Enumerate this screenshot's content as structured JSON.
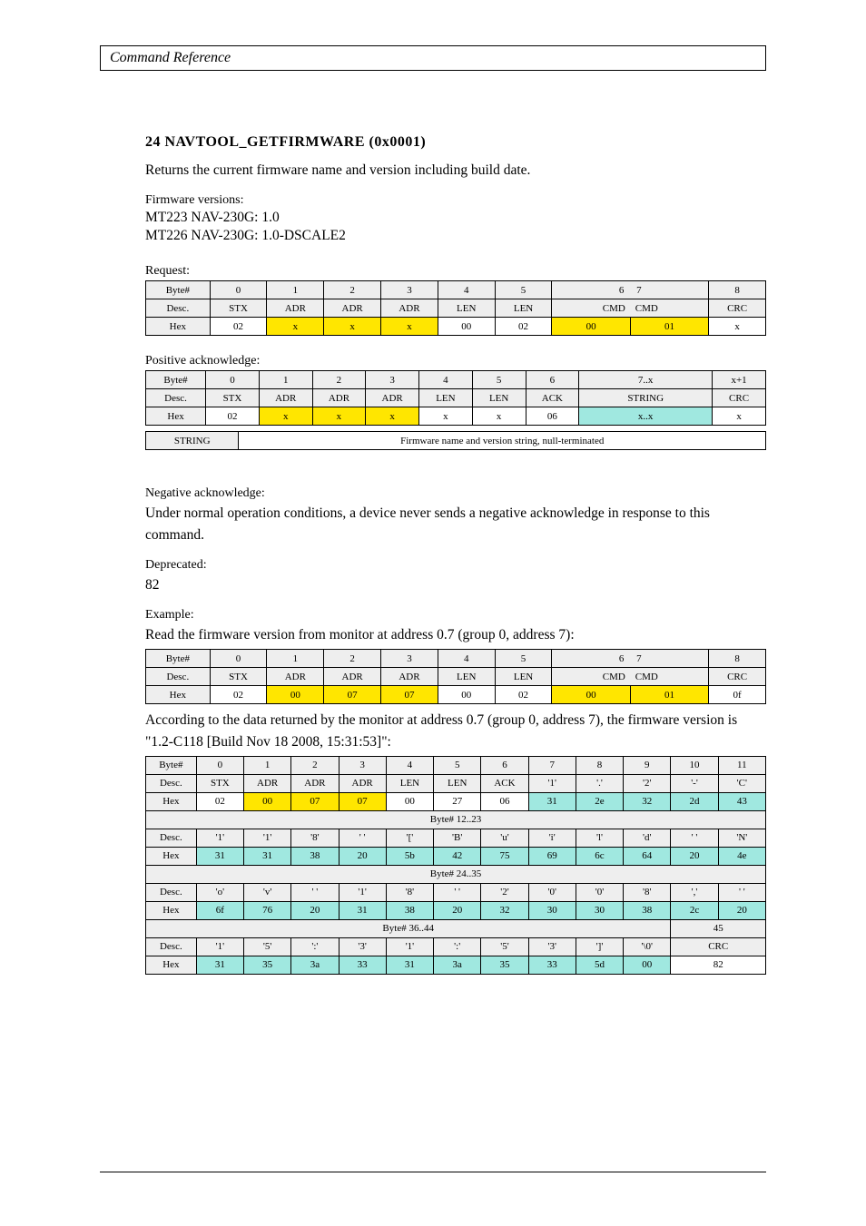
{
  "header": {
    "title": "Command Reference"
  },
  "cmd": {
    "title": "24 NAVTOOL_GETFIRMWARE (0x0001)",
    "desc": "Returns the current firmware name and version including build date.",
    "firmware_head": "Firmware versions:",
    "fw1": "MT223 NAV-230G: 1.0",
    "fw2": "MT226 NAV-230G: 1.0-DSCALE2"
  },
  "req": {
    "label": "Request:",
    "h": [
      "Byte#",
      "0",
      "1",
      "2",
      "3",
      "4",
      "5",
      "6",
      "7",
      "8"
    ],
    "lbl": [
      "Desc.",
      "STX",
      "ADR",
      "ADR",
      "ADR",
      "LEN",
      "LEN",
      "CMD",
      "CMD",
      "CRC"
    ],
    "hexlbl": "Hex",
    "hex": [
      "02",
      "x",
      "x",
      "x",
      "00",
      "02",
      "00",
      "01",
      "x"
    ]
  },
  "ack": {
    "label": "Positive acknowledge:",
    "h": [
      "Byte#",
      "0",
      "1",
      "2",
      "3",
      "4",
      "5",
      "6",
      "7..x",
      "x+1"
    ],
    "lbl": [
      "Desc.",
      "STX",
      "ADR",
      "ADR",
      "ADR",
      "LEN",
      "LEN",
      "ACK",
      "STRING",
      "CRC"
    ],
    "hexlbl": "Hex",
    "hex": [
      "02",
      "x",
      "x",
      "x",
      "x",
      "x",
      "06",
      "x..x",
      "x"
    ],
    "string_label": "STRING",
    "string_desc": "Firmware name and version string, null-terminated"
  },
  "nack": {
    "label": "Negative acknowledge:",
    "text": "Under normal operation conditions, a device never sends a negative acknowledge in response to this command."
  },
  "depr": {
    "label": "Deprecated:",
    "value": "82"
  },
  "example": {
    "label": "Example:",
    "line1": "Read the firmware version from monitor at address 0.7 (group 0, address 7):",
    "tbl1": {
      "h": [
        "Byte#",
        "0",
        "1",
        "2",
        "3",
        "4",
        "5",
        "6",
        "7",
        "8"
      ],
      "lbl": [
        "Desc.",
        "STX",
        "ADR",
        "ADR",
        "ADR",
        "LEN",
        "LEN",
        "CMD",
        "CMD",
        "CRC"
      ],
      "hexlbl": "Hex",
      "hex": [
        "02",
        "00",
        "07",
        "07",
        "00",
        "02",
        "00",
        "01",
        "0f"
      ]
    },
    "line2": "According to the data returned by the monitor at address 0.7 (group 0, address 7), the firmware version is \"1.2-C118 [Build Nov 18 2008, 15:31:53]\":",
    "resp": {
      "row1h": [
        "Byte#",
        "0",
        "1",
        "2",
        "3",
        "4",
        "5",
        "6",
        "7",
        "8",
        "9",
        "10",
        "11"
      ],
      "row1l": [
        "Desc.",
        "STX",
        "ADR",
        "ADR",
        "ADR",
        "LEN",
        "LEN",
        "ACK",
        "'1'",
        "'.'",
        "'2'",
        "'-'",
        "'C'"
      ],
      "row1x": [
        "Hex",
        "02",
        "00",
        "07",
        "07",
        "00",
        "27",
        "06",
        "31",
        "2e",
        "32",
        "2d",
        "43"
      ],
      "row2h": "Byte#     12..23",
      "row2l": [
        "Desc.",
        "'1'",
        "'1'",
        "'8'",
        "' '",
        "'['",
        "'B'",
        "'u'",
        "'i'",
        "'l'",
        "'d'",
        "' '",
        "'N'"
      ],
      "row2x": [
        "Hex",
        "31",
        "31",
        "38",
        "20",
        "5b",
        "42",
        "75",
        "69",
        "6c",
        "64",
        "20",
        "4e"
      ],
      "row3h": "Byte#     24..35",
      "row3l": [
        "Desc.",
        "'o'",
        "'v'",
        "' '",
        "'1'",
        "'8'",
        "' '",
        "'2'",
        "'0'",
        "'0'",
        "'8'",
        "','",
        "' '"
      ],
      "row3x": [
        "Hex",
        "6f",
        "76",
        "20",
        "31",
        "38",
        "20",
        "32",
        "30",
        "30",
        "38",
        "2c",
        "20"
      ],
      "row4h": "Byte#     36..44",
      "row4h_b45": "45",
      "row4l": [
        "Desc.",
        "'1'",
        "'5'",
        "':'",
        "'3'",
        "'1'",
        "':'",
        "'5'",
        "'3'",
        "']'",
        "'\\0'",
        "CRC"
      ],
      "row4x": [
        "Hex",
        "31",
        "35",
        "3a",
        "33",
        "31",
        "3a",
        "35",
        "33",
        "5d",
        "00",
        "82"
      ]
    }
  }
}
